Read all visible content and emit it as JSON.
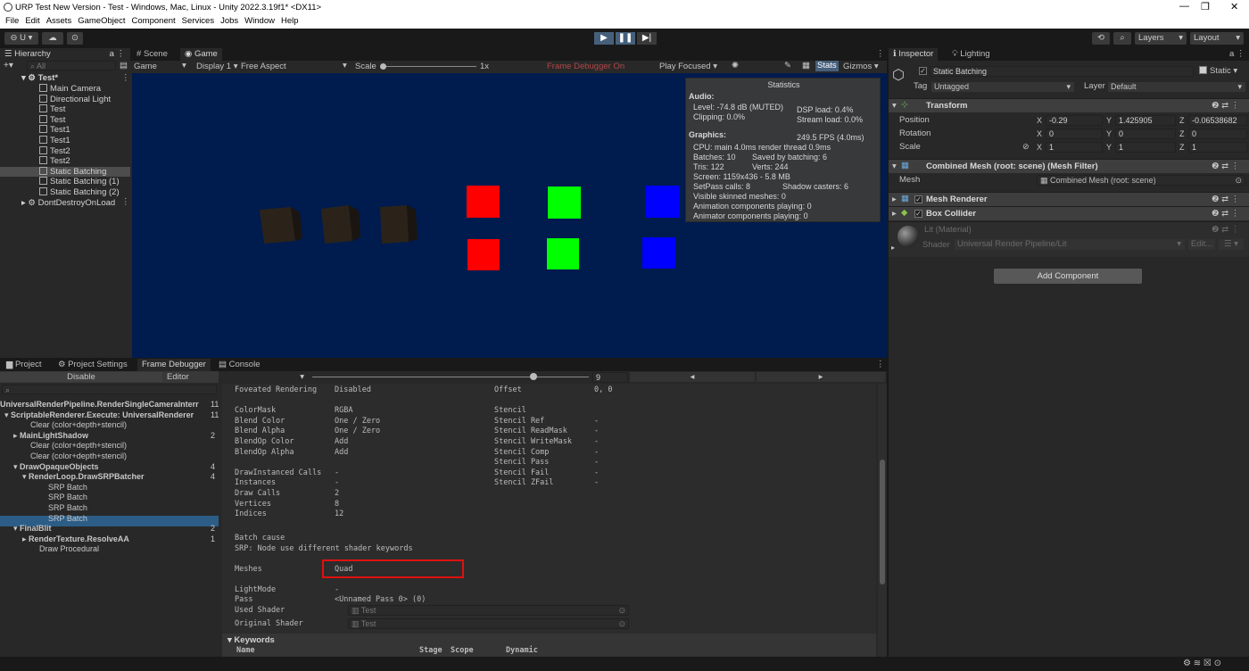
{
  "window": {
    "title": "URP Test New Version - Test - Windows, Mac, Linux - Unity 2022.3.19f1* <DX11>"
  },
  "menu": [
    "File",
    "Edit",
    "Assets",
    "GameObject",
    "Component",
    "Services",
    "Jobs",
    "Window",
    "Help"
  ],
  "toolbar": {
    "account": "U",
    "layers": "Layers",
    "layout": "Layout"
  },
  "hierarchy": {
    "tab": "Hierarchy",
    "search_placeholder": "All",
    "scene": "Test*",
    "items": [
      "Main Camera",
      "Directional Light",
      "Test",
      "Test",
      "Test1",
      "Test1",
      "Test2",
      "Test2",
      "Static Batching",
      "Static Batching (1)",
      "Static Batching (2)"
    ],
    "dontdestroy": "DontDestroyOnLoad"
  },
  "scene_tabs": {
    "scene": "Scene",
    "game": "Game"
  },
  "game_bar": {
    "mode": "Game",
    "display": "Display 1",
    "aspect": "Free Aspect",
    "scale_label": "Scale",
    "scale_value": "1x",
    "frame_debugger": "Frame Debugger On",
    "play_focused": "Play Focused",
    "stats": "Stats",
    "gizmos": "Gizmos"
  },
  "stats": {
    "title": "Statistics",
    "audio_h": "Audio:",
    "level": "Level: -74.8 dB (MUTED)",
    "dsp": "DSP load: 0.4%",
    "clipping": "Clipping: 0.0%",
    "stream": "Stream load: 0.0%",
    "graphics_h": "Graphics:",
    "fps": "249.5 FPS (4.0ms)",
    "cpu": "CPU: main 4.0ms  render thread 0.9ms",
    "batches": "Batches: 10",
    "saved": "Saved by batching: 6",
    "tris": "Tris: 122",
    "verts": "Verts: 244",
    "screen": "Screen: 1159x436 - 5.8 MB",
    "setpass": "SetPass calls: 8",
    "shadow": "Shadow casters: 6",
    "skinned": "Visible skinned meshes: 0",
    "anim": "Animation components playing: 0",
    "animator": "Animator components playing: 0"
  },
  "bottom_tabs": {
    "project": "Project",
    "settings": "Project Settings",
    "framedebugger": "Frame Debugger",
    "console": "Console"
  },
  "fd": {
    "disable": "Disable",
    "editor": "Editor",
    "event_index": "9",
    "tree": [
      {
        "label": "UniversalRenderPipeline.RenderSingleCameraInterr",
        "count": "11",
        "bold": true
      },
      {
        "label": "ScriptableRenderer.Execute: UniversalRenderer",
        "count": "11",
        "bold": true
      },
      {
        "label": "Clear (color+depth+stencil)",
        "count": "",
        "bold": false
      },
      {
        "label": "MainLightShadow",
        "count": "2",
        "bold": true
      },
      {
        "label": "Clear (color+depth+stencil)",
        "count": "",
        "bold": false
      },
      {
        "label": "Clear (color+depth+stencil)",
        "count": "",
        "bold": false
      },
      {
        "label": "DrawOpaqueObjects",
        "count": "4",
        "bold": true
      },
      {
        "label": "RenderLoop.DrawSRPBatcher",
        "count": "4",
        "bold": true
      },
      {
        "label": "SRP Batch",
        "count": "",
        "bold": false
      },
      {
        "label": "SRP Batch",
        "count": "",
        "bold": false
      },
      {
        "label": "SRP Batch",
        "count": "",
        "bold": false
      },
      {
        "label": "SRP Batch",
        "count": "",
        "bold": false
      },
      {
        "label": "FinalBlit",
        "count": "2",
        "bold": true
      },
      {
        "label": "RenderTexture.ResolveAA",
        "count": "1",
        "bold": true
      },
      {
        "label": "Draw Procedural",
        "count": "",
        "bold": false
      }
    ],
    "details_left": [
      [
        "Foveated Rendering",
        "Disabled"
      ],
      [
        "",
        ""
      ],
      [
        "ColorMask",
        "RGBA"
      ],
      [
        "Blend Color",
        "One / Zero"
      ],
      [
        "Blend Alpha",
        "One / Zero"
      ],
      [
        "BlendOp Color",
        "Add"
      ],
      [
        "BlendOp Alpha",
        "Add"
      ],
      [
        "",
        ""
      ],
      [
        "DrawInstanced Calls",
        "-"
      ],
      [
        "Instances",
        "-"
      ],
      [
        "Draw Calls",
        "2"
      ],
      [
        "Vertices",
        "8"
      ],
      [
        "Indices",
        "12"
      ]
    ],
    "details_right": [
      [
        "Offset",
        "0, 0"
      ],
      [
        "",
        ""
      ],
      [
        "Stencil",
        ""
      ],
      [
        "Stencil Ref",
        "-"
      ],
      [
        "Stencil ReadMask",
        "-"
      ],
      [
        "Stencil WriteMask",
        "-"
      ],
      [
        "Stencil Comp",
        "-"
      ],
      [
        "Stencil Pass",
        "-"
      ],
      [
        "Stencil Fail",
        "-"
      ],
      [
        "Stencil ZFail",
        "-"
      ]
    ],
    "batch_cause_h": "Batch cause",
    "batch_cause": "SRP: Node use different shader keywords",
    "meshes_label": "Meshes",
    "meshes_value": "Quad",
    "lightmode_label": "LightMode",
    "lightmode_value": "-",
    "pass_label": "Pass",
    "pass_value": "<Unnamed Pass 0> (0)",
    "used_shader_label": "Used Shader",
    "used_shader": "Test",
    "orig_shader_label": "Original Shader",
    "orig_shader": "Test",
    "keywords": "Keywords",
    "kw_cols": [
      "Name",
      "Stage",
      "Scope",
      "Dynamic"
    ]
  },
  "inspector": {
    "tab": "Inspector",
    "lighting": "Lighting",
    "object": "Static Batching",
    "static": "Static",
    "tag_label": "Tag",
    "tag": "Untagged",
    "layer_label": "Layer",
    "layer": "Default",
    "transform": "Transform",
    "position": "Position",
    "rotation": "Rotation",
    "scale": "Scale",
    "pos": {
      "x": "-0.29",
      "y": "1.425905",
      "z": "-0.06538682"
    },
    "rot": {
      "x": "0",
      "y": "0",
      "z": "0"
    },
    "scl": {
      "x": "1",
      "y": "1",
      "z": "1"
    },
    "meshfilter": "Combined Mesh (root: scene) (Mesh Filter)",
    "mesh_label": "Mesh",
    "mesh_value": "Combined Mesh (root: scene)",
    "renderer": "Mesh Renderer",
    "collider": "Box Collider",
    "material": "Lit (Material)",
    "shader_label": "Shader",
    "shader": "Universal Render Pipeline/Lit",
    "edit": "Edit...",
    "add_component": "Add Component"
  },
  "colors": {
    "game_bg": "#001b4e",
    "red": "#ff0000",
    "green": "#00ff00",
    "blue": "#0000ff",
    "accent": "#2c5d87"
  }
}
